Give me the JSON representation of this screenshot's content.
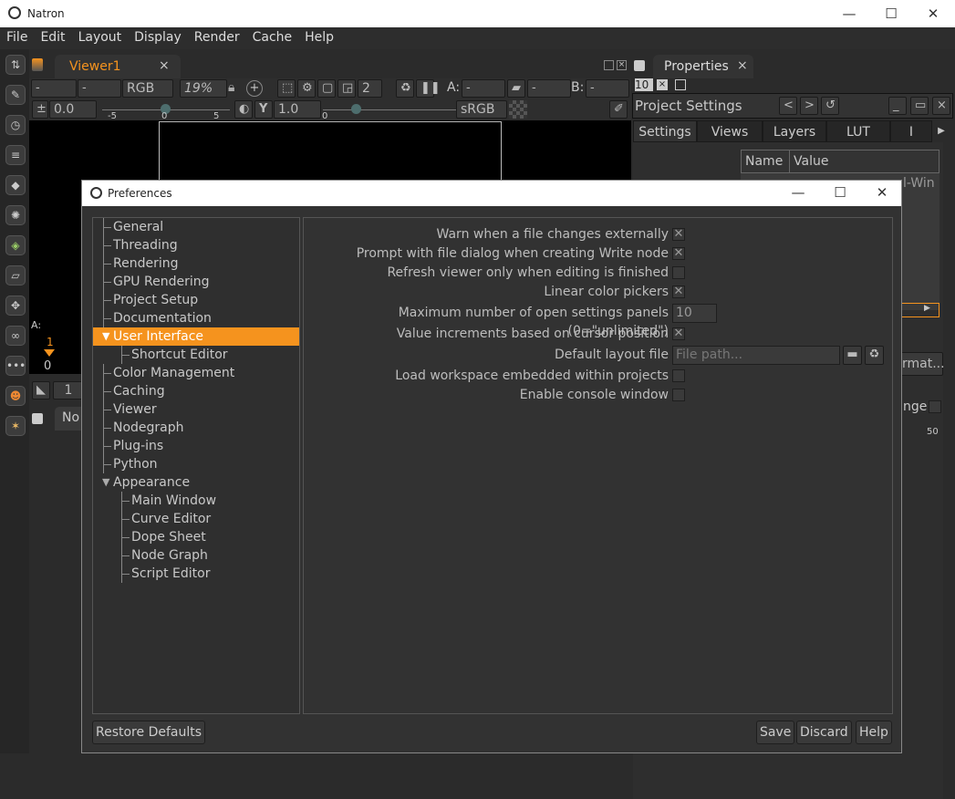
{
  "window": {
    "title": "Natron"
  },
  "menu": [
    "File",
    "Edit",
    "Layout",
    "Display",
    "Render",
    "Cache",
    "Help"
  ],
  "viewer": {
    "tab": "Viewer1",
    "layer": "-",
    "alpha": "-",
    "channels": "RGB",
    "zoom": "19%",
    "view": "2",
    "a_label": "A:",
    "a_value": "-",
    "b_label": "B:",
    "b_value": "-",
    "mid_value": "-",
    "gain": "0.0",
    "gain_ticks": [
      "-5",
      "0",
      "5"
    ],
    "gamma": "1.0",
    "gamma_ticks": [
      "0"
    ],
    "colorspace": "sRGB"
  },
  "timeline": {
    "label": "A:",
    "frame": "1",
    "zero": "0",
    "value": "1",
    "nodes_tab": "No"
  },
  "properties": {
    "tab": "Properties",
    "max_panels": "10",
    "panel_title": "Project Settings",
    "tabs": [
      "Settings",
      "Views",
      "Layers",
      "LUT",
      "I"
    ],
    "table_headers": [
      "Name",
      "Value"
    ],
    "cell_fragment": "l-Win",
    "format_btn": "rmat...",
    "range_label": "nge",
    "slider_tick": "50"
  },
  "prefs": {
    "title": "Preferences",
    "tree": [
      {
        "label": "General",
        "level": 0
      },
      {
        "label": "Threading",
        "level": 0
      },
      {
        "label": "Rendering",
        "level": 0
      },
      {
        "label": "GPU Rendering",
        "level": 0
      },
      {
        "label": "Project Setup",
        "level": 0
      },
      {
        "label": "Documentation",
        "level": 0
      },
      {
        "label": "User Interface",
        "level": 0,
        "expanded": true,
        "selected": true
      },
      {
        "label": "Shortcut Editor",
        "level": 1
      },
      {
        "label": "Color Management",
        "level": 0
      },
      {
        "label": "Caching",
        "level": 0
      },
      {
        "label": "Viewer",
        "level": 0
      },
      {
        "label": "Nodegraph",
        "level": 0
      },
      {
        "label": "Plug-ins",
        "level": 0
      },
      {
        "label": "Python",
        "level": 0
      },
      {
        "label": "Appearance",
        "level": 0,
        "expanded": true
      },
      {
        "label": "Main Window",
        "level": 1
      },
      {
        "label": "Curve Editor",
        "level": 1
      },
      {
        "label": "Dope Sheet",
        "level": 1
      },
      {
        "label": "Node Graph",
        "level": 1
      },
      {
        "label": "Script Editor",
        "level": 1
      }
    ],
    "settings": [
      {
        "label": "Warn when a file changes externally",
        "type": "checkbox",
        "checked": true
      },
      {
        "label": "Prompt with file dialog when creating Write node",
        "type": "checkbox",
        "checked": true
      },
      {
        "label": "Refresh viewer only when editing is finished",
        "type": "checkbox",
        "checked": false
      },
      {
        "label": "Linear color pickers",
        "type": "checkbox",
        "checked": true
      },
      {
        "label": "Maximum number of open settings panels (0=\"unlimited\")",
        "type": "number",
        "value": "10"
      },
      {
        "label": "Value increments based on cursor position",
        "type": "checkbox",
        "checked": true
      },
      {
        "label": "Default layout file",
        "type": "file",
        "placeholder": "File path..."
      },
      {
        "label": "Load workspace embedded within projects",
        "type": "checkbox",
        "checked": false
      },
      {
        "label": "Enable console window",
        "type": "checkbox",
        "checked": false
      }
    ],
    "buttons": {
      "restore": "Restore Defaults",
      "save": "Save",
      "discard": "Discard",
      "help": "Help"
    }
  },
  "colors": {
    "accent": "#f5931e",
    "bg": "#323232"
  }
}
